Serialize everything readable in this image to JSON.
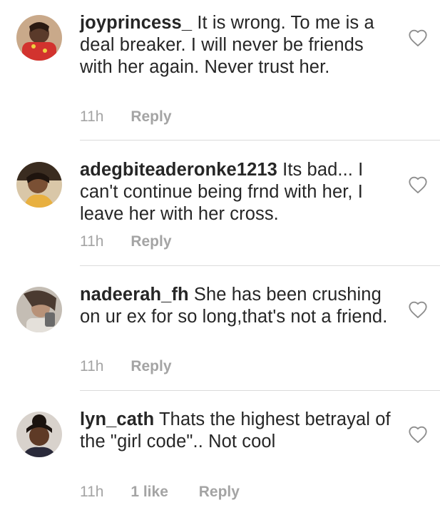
{
  "comments": [
    {
      "username": "joyprincess_",
      "text": "It is wrong. To me is a deal breaker. I will never be friends with her again. Never trust her.",
      "time": "11h",
      "likes": "",
      "reply_label": "Reply"
    },
    {
      "username": "adegbiteaderonke1213",
      "text": "Its bad... I can't continue being frnd with her, I leave her with her cross.",
      "time": "11h",
      "likes": "",
      "reply_label": "Reply"
    },
    {
      "username": "nadeerah_fh",
      "text": "She has been crushing on ur ex for so long,that's not a friend.",
      "time": "11h",
      "likes": "",
      "reply_label": "Reply"
    },
    {
      "username": "lyn_cath",
      "text": "Thats the highest betrayal of the \"girl code\".. Not cool",
      "time": "11h",
      "likes": "1 like",
      "reply_label": "Reply"
    }
  ],
  "icons": {
    "like": "heart-outline-icon"
  },
  "colors": {
    "text": "#262626",
    "meta": "#a4a4a4",
    "divider": "#dbdbdb"
  }
}
